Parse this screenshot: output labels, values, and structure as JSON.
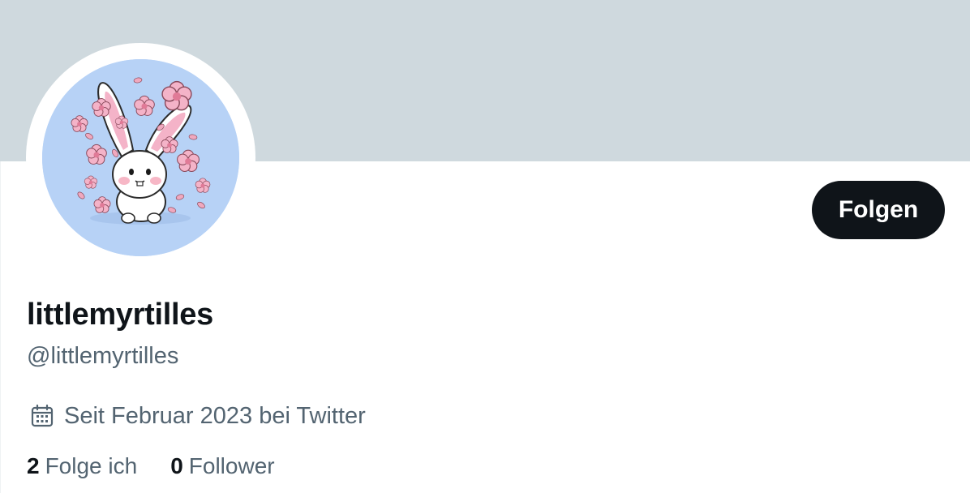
{
  "profile": {
    "display_name": "littlemyrtilles",
    "handle": "@littlemyrtilles",
    "joined_text": "Seit Februar 2023 bei Twitter",
    "joined_icon": "calendar-icon",
    "avatar_description": "cartoon white rabbit with pink ears among cherry blossoms"
  },
  "actions": {
    "follow_label": "Folgen"
  },
  "stats": {
    "following_count": "2",
    "following_label": "Folge ich",
    "followers_count": "0",
    "followers_label": "Follower"
  },
  "colors": {
    "banner": "#cfd9de",
    "avatar_bg": "#b7d2f6",
    "button_bg": "#0f1419",
    "primary_text": "#0f1419",
    "secondary_text": "#536471"
  }
}
